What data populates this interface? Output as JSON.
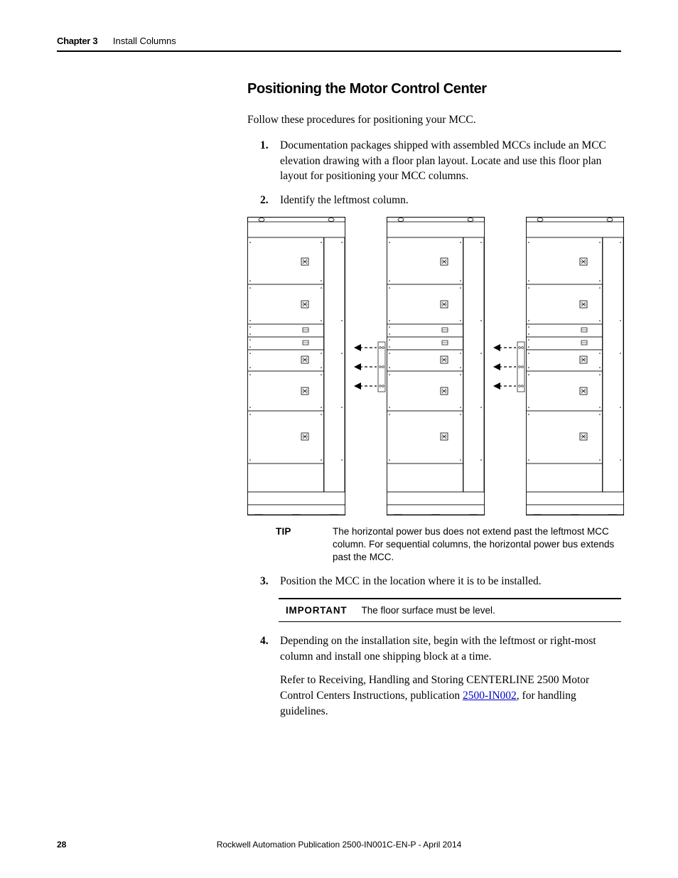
{
  "header": {
    "chapter_label": "Chapter 3",
    "chapter_title": "Install Columns"
  },
  "heading": "Positioning the Motor Control Center",
  "intro": "Follow these procedures for positioning your MCC.",
  "steps": {
    "s1": {
      "num": "1.",
      "text": "Documentation packages shipped with assembled MCCs include an MCC elevation drawing with a floor plan layout. Locate and use this floor plan layout for positioning your MCC columns."
    },
    "s2": {
      "num": "2.",
      "text": "Identify the leftmost column."
    },
    "s3": {
      "num": "3.",
      "text": "Position the MCC in the location where it is to be installed."
    },
    "s4": {
      "num": "4.",
      "text": "Depending on the installation site, begin with the leftmost or right-most column and install one shipping block at a time."
    }
  },
  "tip": {
    "label": "TIP",
    "text": "The horizontal power bus does not extend past the leftmost MCC column. For sequential columns, the horizontal power bus extends past the MCC."
  },
  "important": {
    "label": "IMPORTANT",
    "text": "The floor surface must be level."
  },
  "ref_para_before": "Refer to Receiving, Handling and Storing CENTERLINE 2500 Motor Control Centers Instructions, publication ",
  "ref_link_text": "2500-IN002",
  "ref_para_after": ", for handling guidelines.",
  "footer": {
    "page": "28",
    "pub": "Rockwell Automation Publication 2500-IN001C-EN-P - April 2014"
  }
}
